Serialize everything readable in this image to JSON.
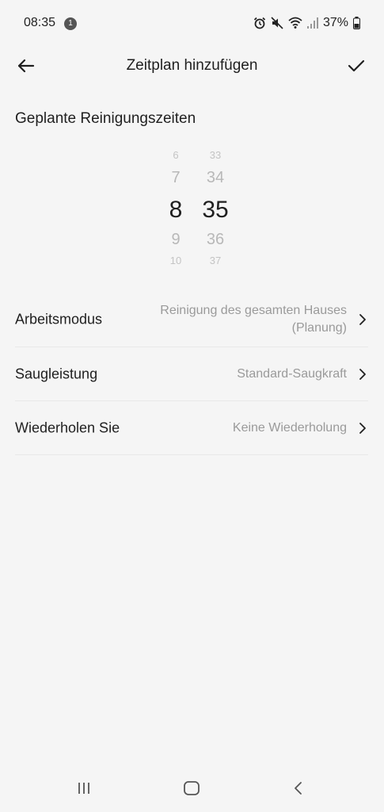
{
  "status_bar": {
    "time": "08:35",
    "notification_count": "1",
    "battery": "37%"
  },
  "header": {
    "title": "Zeitplan hinzufügen"
  },
  "section": {
    "title": "Geplante Reinigungszeiten"
  },
  "time_picker": {
    "hours": [
      "6",
      "7",
      "8",
      "9",
      "10"
    ],
    "minutes": [
      "33",
      "34",
      "35",
      "36",
      "37"
    ],
    "selected_hour": "8",
    "selected_minute": "35"
  },
  "settings": [
    {
      "label": "Arbeitsmodus",
      "value_line1": "Reinigung des gesamten Hauses",
      "value_line2": "(Planung)"
    },
    {
      "label": "Saugleistung",
      "value": "Standard-Saugkraft"
    },
    {
      "label": "Wiederholen Sie",
      "value": "Keine Wiederholung"
    }
  ],
  "colors": {
    "background": "#f5f5f5",
    "primary_text": "#1f1f1f",
    "secondary_text": "#9a9a9a",
    "picker_inactive": "#b8b8b8",
    "divider": "#e8e8e8"
  }
}
